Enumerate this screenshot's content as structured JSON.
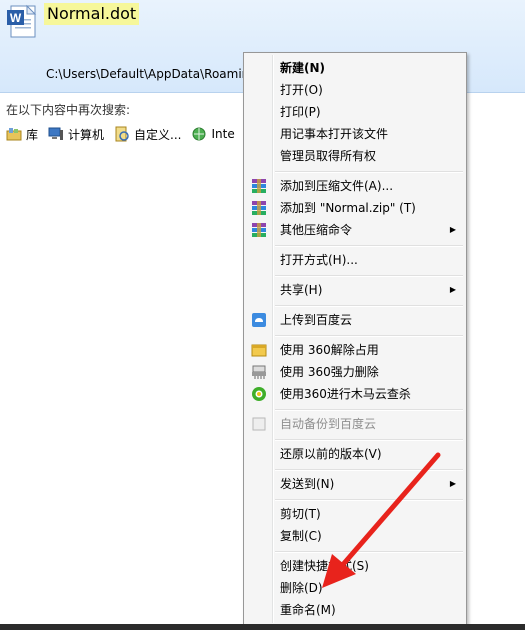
{
  "result": {
    "file_name": "Normal.dot",
    "file_path": "C:\\Users\\Default\\AppData\\Roamin"
  },
  "search_again": {
    "label": "在以下内容中再次搜索:",
    "locations": [
      {
        "label": "库",
        "icon": "library-icon"
      },
      {
        "label": "计算机",
        "icon": "computer-icon"
      },
      {
        "label": "自定义...",
        "icon": "custom-icon"
      },
      {
        "label": "Inte",
        "icon": "internet-icon"
      }
    ]
  },
  "menu": {
    "items": [
      {
        "label": "新建(N)",
        "bold": true
      },
      {
        "label": "打开(O)"
      },
      {
        "label": "打印(P)"
      },
      {
        "label": "用记事本打开该文件"
      },
      {
        "label": "管理员取得所有权"
      },
      {
        "label": "添加到压缩文件(A)...",
        "icon": "winrar-icon"
      },
      {
        "label": "添加到 \"Normal.zip\" (T)",
        "icon": "winrar-icon"
      },
      {
        "label": "其他压缩命令",
        "icon": "winrar-icon",
        "submenu": true
      },
      {
        "label": "打开方式(H)..."
      },
      {
        "label": "共享(H)",
        "submenu": true
      },
      {
        "label": "上传到百度云",
        "icon": "baidu-cloud-icon"
      },
      {
        "label": "使用 360解除占用",
        "icon": "unlock-360-icon"
      },
      {
        "label": "使用 360强力删除",
        "icon": "shred-360-icon"
      },
      {
        "label": "使用360进行木马云查杀",
        "icon": "scan-360-icon"
      },
      {
        "label": "自动备份到百度云",
        "icon": "backup-checkbox-icon",
        "disabled": true
      },
      {
        "label": "还原以前的版本(V)"
      },
      {
        "label": "发送到(N)",
        "submenu": true
      },
      {
        "label": "剪切(T)"
      },
      {
        "label": "复制(C)"
      },
      {
        "label": "创建快捷方式(S)"
      },
      {
        "label": "删除(D)"
      },
      {
        "label": "重命名(M)"
      }
    ],
    "submenu_arrow": "▶"
  },
  "colors": {
    "highlight": "#f6f79a",
    "menu_bg": "#f5f5f5",
    "arrow": "#e8231c"
  }
}
